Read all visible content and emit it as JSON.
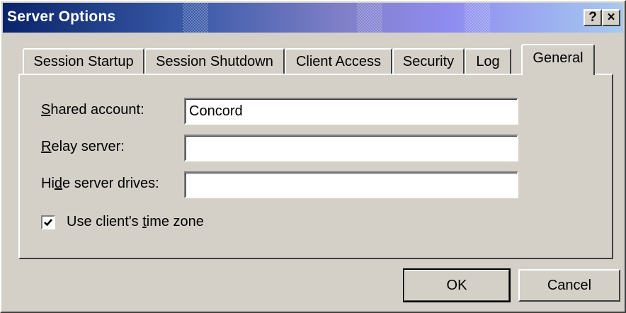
{
  "window": {
    "title": "Server Options",
    "help_label": "?",
    "close_label": "×"
  },
  "tabs": [
    {
      "label": "Session Startup",
      "active": false
    },
    {
      "label": "Session Shutdown",
      "active": false
    },
    {
      "label": "Client Access",
      "active": false
    },
    {
      "label": "Security",
      "active": false
    },
    {
      "label": "Log",
      "active": false
    },
    {
      "label": "General",
      "active": true
    }
  ],
  "general": {
    "shared_account": {
      "label_pre": "",
      "label_key": "S",
      "label_post": "hared account:",
      "value": "Concord"
    },
    "relay_server": {
      "label_pre": "",
      "label_key": "R",
      "label_post": "elay server:",
      "value": ""
    },
    "hide_server_drives": {
      "label_pre": "Hi",
      "label_key": "d",
      "label_post": "e server drives:",
      "value": ""
    },
    "use_client_time_zone": {
      "label_pre": "Use client's ",
      "label_key": "t",
      "label_post": "ime zone",
      "checked": true
    }
  },
  "buttons": {
    "ok_label": "OK",
    "cancel_label": "Cancel"
  }
}
